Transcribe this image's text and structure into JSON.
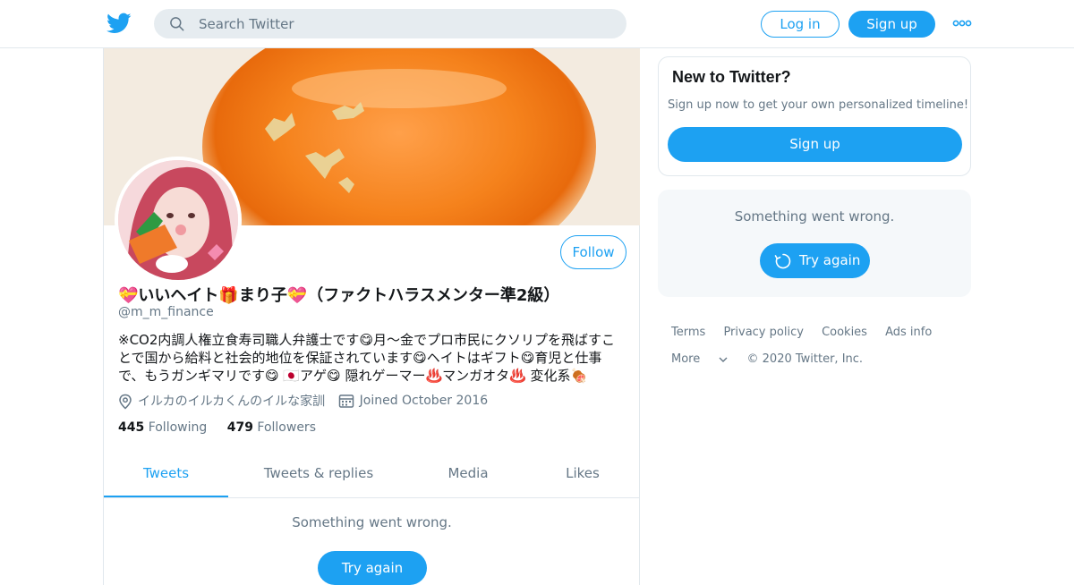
{
  "header": {
    "search_placeholder": "Search Twitter",
    "login_label": "Log in",
    "signup_label": "Sign up",
    "logo_icon": "twitter-bird-icon",
    "more_icon": "more-dots-icon",
    "search_icon": "search-icon"
  },
  "profile": {
    "display_name": "💝いいヘイト🎁まり子💝（ファクトハラスメンター準2級）",
    "screen_name": "@m_m_finance",
    "bio": "※CO2内調人権立食寿司職人弁護士です😋月〜金でプロ市民にクソリプを飛ばすことで国から給料と社会的地位を保証されています😋ヘイトはギフト😋育児と仕事で、もうガンギマリです😋 🇯🇵アゲ😋 隠れゲーマー♨️マンガオタ♨️ 変化系🍖",
    "location": "イルカのイルカくんのイルな家訓",
    "joined": "Joined October 2016",
    "following_count": "445",
    "following_label": "Following",
    "followers_count": "479",
    "followers_label": "Followers",
    "follow_label": "Follow"
  },
  "tabs": [
    {
      "label": "Tweets",
      "active": true
    },
    {
      "label": "Tweets & replies",
      "active": false
    },
    {
      "label": "Media",
      "active": false
    },
    {
      "label": "Likes",
      "active": false
    }
  ],
  "timeline": {
    "error_text": "Something went wrong.",
    "retry_label": "Try again"
  },
  "sidebar": {
    "new_title": "New to Twitter?",
    "new_sub": "Sign up now to get your own personalized timeline!",
    "signup_label": "Sign up",
    "error_text": "Something went wrong.",
    "retry_label": "Try again"
  },
  "footer": {
    "links": [
      "Terms",
      "Privacy policy",
      "Cookies",
      "Ads info"
    ],
    "more_label": "More",
    "copyright": "© 2020 Twitter, Inc."
  },
  "colors": {
    "accent": "#1da1f2",
    "muted": "#657786",
    "border": "#e1e8ed"
  }
}
